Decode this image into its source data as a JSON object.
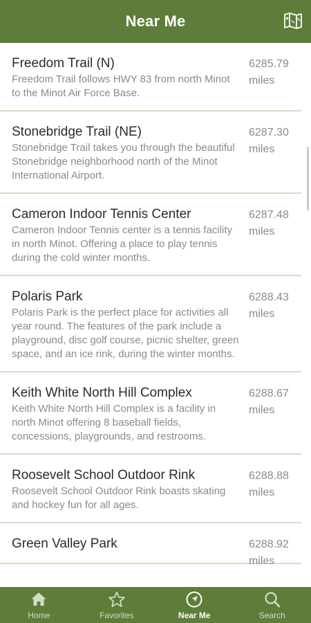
{
  "header": {
    "title": "Near Me",
    "map_icon": "map-icon"
  },
  "places": [
    {
      "name": "Freedom Trail (N)",
      "description": "Freedom Trail follows HWY 83 from north Minot to the Minot Air Force Base.",
      "distance": "6285.79",
      "unit": "miles"
    },
    {
      "name": "Stonebridge Trail (NE)",
      "description": "Stonebridge Trail takes you through the beautiful Stonebridge neighborhood north of the Minot International Airport.",
      "distance": "6287.30",
      "unit": "miles"
    },
    {
      "name": "Cameron Indoor Tennis Center",
      "description": "Cameron Indoor Tennis center is a tennis facility in north Minot.  Offering a place to play tennis during the cold winter months.",
      "distance": "6287.48",
      "unit": "miles"
    },
    {
      "name": "Polaris Park",
      "description": "Polaris Park is the perfect place for activities all year round. The features of the park include a playground, disc golf course, picnic shelter, green space, and an ice rink, during the winter months.",
      "distance": "6288.43",
      "unit": "miles"
    },
    {
      "name": "Keith White North Hill Complex",
      "description": "Keith White North Hill Complex is a facility in north Minot offering 8 baseball fields, concessions, playgrounds, and restrooms.",
      "distance": "6288.67",
      "unit": "miles"
    },
    {
      "name": "Roosevelt School Outdoor Rink",
      "description": "Roosevelt School Outdoor Rink boasts skating and hockey fun for all ages.",
      "distance": "6288.88",
      "unit": "miles"
    },
    {
      "name": "Green Valley Park",
      "description": "",
      "distance": "6288.92",
      "unit": "miles"
    }
  ],
  "tabs": [
    {
      "label": "Home",
      "icon": "home-icon",
      "active": false
    },
    {
      "label": "Favorites",
      "icon": "star-icon",
      "active": false
    },
    {
      "label": "Near Me",
      "icon": "compass-icon",
      "active": true
    },
    {
      "label": "Search",
      "icon": "search-icon",
      "active": false
    }
  ],
  "colors": {
    "brand": "#5e7d39",
    "divider": "#d8ddc4",
    "title_text": "#2b2b2b",
    "secondary_text": "#8a8a8a"
  }
}
